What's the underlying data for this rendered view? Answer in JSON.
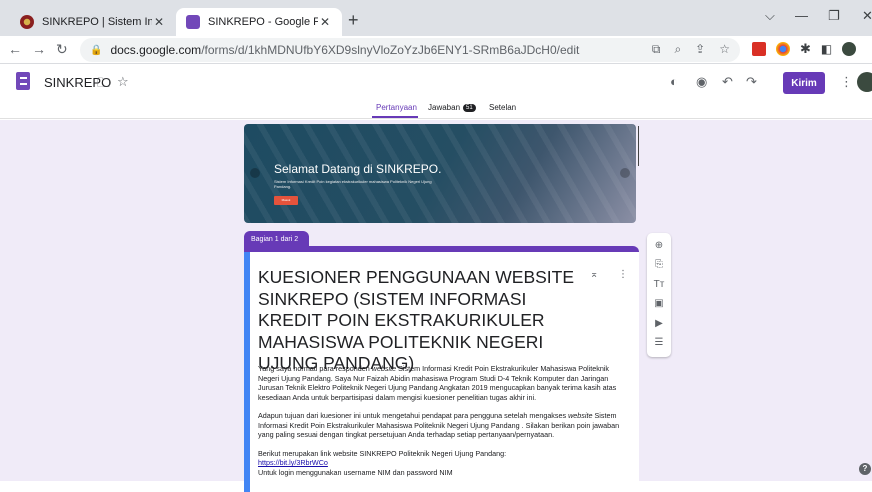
{
  "browser": {
    "tabs": [
      {
        "title": "SINKREPO | Sistem Informasi Kre",
        "close": "✕"
      },
      {
        "title": "SINKREPO - Google Formulir",
        "close": "✕"
      }
    ],
    "new_tab": "+",
    "url_host": "docs.google.com",
    "url_path": "/forms/d/1khMDNUfbY6XD9slnyVloZoYzJb6ENY1-SRmB6aJDcH0/edit"
  },
  "form_header": {
    "name": "SINKREPO",
    "send_label": "Kirim"
  },
  "form_tabs": [
    {
      "label": "Pertanyaan"
    },
    {
      "label": "Jawaban",
      "badge": "51"
    },
    {
      "label": "Setelan"
    }
  ],
  "banner": {
    "heading": "Selamat Datang di SINKREPO.",
    "subtitle": "Sistem Informasi Kredit Poin kegiatan ekstrakurikuler mahasiswa Politeknik Negeri Ujung Pandang.",
    "button": "Masuk"
  },
  "section_label": "Bagian 1 dari 2",
  "form": {
    "title": "KUESIONER PENGGUNAAN WEBSITE SINKREPO (SISTEM INFORMASI KREDIT POIN EKSTRAKURIKULER MAHASISWA POLITEKNIK NEGERI UJUNG PANDANG)",
    "para1_a": "Yang saya hormati para responden ",
    "para1_em": "website",
    "para1_b": " Sistem Informasi Kredit Poin Ekstrakurikuler Mahasiswa Politeknik Negeri Ujung Pandang. Saya Nur Faizah Abidin mahasiswa Program Studi D-4 Teknik Komputer dan Jaringan Jurusan Teknik Elektro Politeknik Negeri Ujung Pandang Angkatan 2019 mengucapkan banyak terima kasih atas kesediaan Anda untuk berpartisipasi dalam mengisi kuesioner penelitian tugas akhir ini.",
    "para2_a": "Adapun tujuan dari kuesioner ini untuk mengetahui pendapat para pengguna setelah mengakses ",
    "para2_em": "website",
    "para2_b": " Sistem Informasi Kredit Poin Ekstrakurikuler Mahasiswa Politeknik Negeri Ujung Pandang . Silakan berikan poin jawaban yang paling sesuai dengan tingkat persetujuan Anda terhadap setiap pertanyaan/pernyataan.",
    "para3": "Berikut merupakan link website SINKREPO Politeknik Negeri Ujung Pandang:",
    "link": "https://bit.ly/3RbrWCo",
    "para4": "Untuk login menggunakan username NIM dan password NIM"
  },
  "help": "?"
}
